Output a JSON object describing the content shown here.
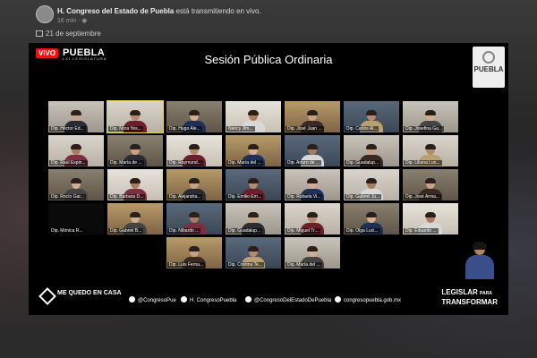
{
  "post": {
    "title_bold": "H. Congreso del Estado de Puebla",
    "title_rest": " está transmitiendo en vivo.",
    "time": "16 min",
    "date": "21 de septiembre"
  },
  "stream": {
    "live_label": "VIVO",
    "brand": "PUEBLA",
    "brand_sub": "LXI LEGISLATURA",
    "session_title": "Sesión Pública Ordinaria",
    "badge_text": "PUEBLA"
  },
  "participants": [
    "Dip. Héctor Ed...",
    "Dip. Nora Yes...",
    "Dip. Hugo Ale...",
    "Nancy Jim...",
    "Dip. José Juan ...",
    "Dip. Carlos Al...",
    "Dip. Josefina Ga...",
    "Dip. Raúl Espin...",
    "Dip. María de ...",
    "Dip. Raymund...",
    "Dip. María del ...",
    "Dip. Arturo de ...",
    "Dip. Guadalup...",
    "Dip. Liliana Lun...",
    "Dip. Rocío Gar...",
    "Dip. Barbara D...",
    "Dip. Alejandra...",
    "Dip. Emilio Ern...",
    "Dip. Rafaela Vi...",
    "Dip. Gabriel Ju...",
    "Dip. José Arma...",
    "Dip. Mónica R...",
    "Dip. Gabriel B...",
    "Dip. Nibardo ...",
    "Dip. Guadalup...",
    "Dip. Miguel Tr...",
    "Dip. Olga Luci...",
    "Dip. Eduardo ...",
    "Dip. Luis Ferna...",
    "Dip. Cristina Te...",
    "Dip. María del ..."
  ],
  "footer": {
    "left_logo": "ME QUEDO EN CASA",
    "twitter": "@CongresoPue",
    "facebook": "H. CongresoPuebla",
    "instagram": "@CongresoDelEstadoDePuebla",
    "website": "congresopuebla.gob.mx",
    "right_logo_a": "LEGISLAR",
    "right_logo_small": "PARA",
    "right_logo_b": "TRANSFORMAR"
  },
  "colors": {
    "live": "#ee1111",
    "active_border": "#e3d14a",
    "stream_bg": "#000000"
  },
  "icons": [
    "calendar-icon",
    "globe-icon",
    "twitter-icon",
    "facebook-icon",
    "instagram-icon",
    "web-icon"
  ]
}
